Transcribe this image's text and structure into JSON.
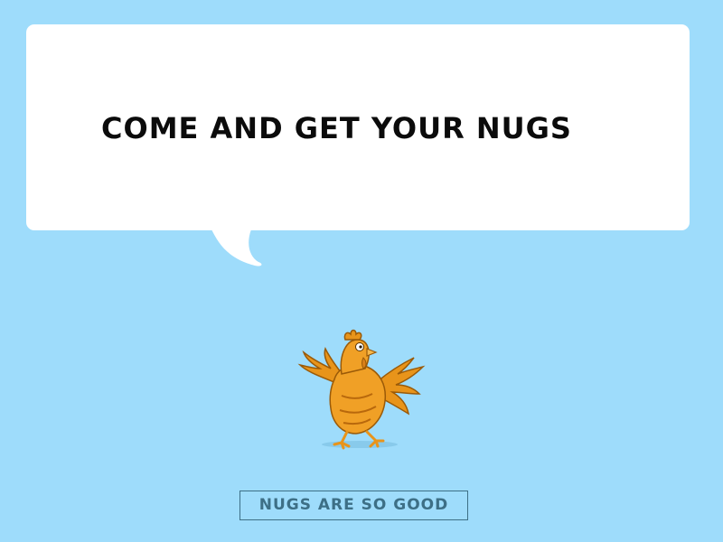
{
  "dialog": {
    "text": "COME AND GET YOUR NUGS"
  },
  "choice": {
    "label": "NUGS ARE SO GOOD"
  },
  "character": {
    "icon": "chicken-icon",
    "color": "#e8941a"
  },
  "colors": {
    "background": "#9edcfb",
    "bubble": "#ffffff",
    "button_border": "#3d6f86"
  }
}
